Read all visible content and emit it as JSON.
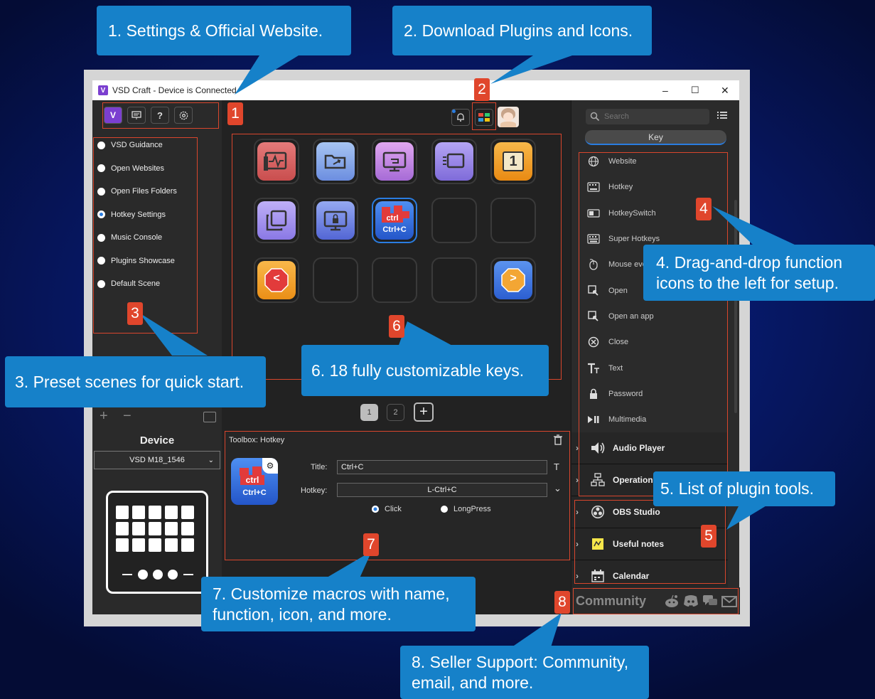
{
  "callouts": {
    "c1": "1. Settings & Official Website.",
    "c2": "2. Download Plugins and Icons.",
    "c3": "3. Preset scenes for quick start.",
    "c4": "4. Drag-and-drop function icons to the left for setup.",
    "c5": "5. List of plugin tools.",
    "c6": "6. 18 fully customizable keys.",
    "c7": "7. Customize macros with name, function, icon, and more.",
    "c8": "8. Seller Support: Community, email, and more."
  },
  "markers": [
    "1",
    "2",
    "3",
    "4",
    "5",
    "6",
    "7",
    "8"
  ],
  "window": {
    "title": "VSD Craft - Device is Connected",
    "min": "–",
    "max": "☐",
    "close": "✕"
  },
  "toolbar": {
    "help": "?"
  },
  "scenes": [
    {
      "label": "VSD Guidance",
      "selected": false
    },
    {
      "label": "Open Websites",
      "selected": false
    },
    {
      "label": "Open Files Folders",
      "selected": false
    },
    {
      "label": "Hotkey Settings",
      "selected": true
    },
    {
      "label": "Music Console",
      "selected": false
    },
    {
      "label": "Plugins Showcase",
      "selected": false
    },
    {
      "label": "Default Scene",
      "selected": false
    }
  ],
  "scene_controls": {
    "add": "+",
    "remove": "−"
  },
  "device": {
    "heading": "Device",
    "selected": "VSD M18_1546"
  },
  "keys": {
    "k5": "1",
    "k8": "Ctrl+C",
    "k8_top": "ctrl",
    "prev": "<",
    "next": ">"
  },
  "pages": {
    "p1": "1",
    "p2": "2",
    "add": "+"
  },
  "toolbox": {
    "title": "Toolbox:  Hotkey",
    "icon_label": "Ctrl+C",
    "icon_top": "ctrl",
    "title_label": "Title:",
    "title_value": "Ctrl+C",
    "title_T": "T",
    "hotkey_label": "Hotkey:",
    "hotkey_value": "L-Ctrl+C",
    "click": "Click",
    "longpress": "LongPress"
  },
  "search": {
    "placeholder": "Search"
  },
  "tabs": {
    "key": "Key"
  },
  "functions": [
    "Website",
    "Hotkey",
    "HotkeySwitch",
    "Super Hotkeys",
    "Mouse event",
    "Open",
    "Open an app",
    "Close",
    "Text",
    "Password",
    "Multimedia"
  ],
  "plugins": [
    "Audio Player",
    "Operation Flow",
    "OBS Studio",
    "Useful notes",
    "Calendar"
  ],
  "community": {
    "label": "Community"
  },
  "colors": {
    "callout": "#1681c9",
    "marker": "#e0462c",
    "accent": "#2a7de1",
    "app_bg": "#222222"
  }
}
